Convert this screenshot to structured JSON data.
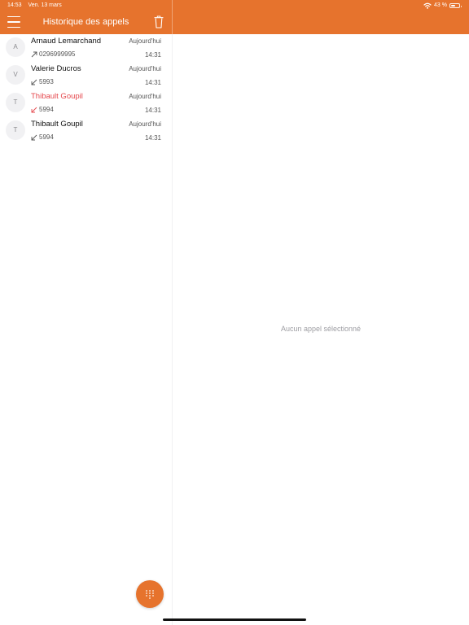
{
  "status_bar": {
    "time": "14:53",
    "date": "Ven. 13 mars",
    "battery": "43 %",
    "battery_level": 0.43
  },
  "header": {
    "title": "Historique des appels",
    "menu_icon": "hamburger-icon",
    "trash_icon": "trash-icon"
  },
  "colors": {
    "accent": "#e6732d",
    "missed": "#e5484d"
  },
  "calls": [
    {
      "initial": "A",
      "name": "Arnaud Lemarchand",
      "number": "0296999995",
      "date": "Aujourd'hui",
      "time": "14:31",
      "direction": "outgoing",
      "missed": false
    },
    {
      "initial": "V",
      "name": "Valerie Ducros",
      "number": "5993",
      "date": "Aujourd'hui",
      "time": "14:31",
      "direction": "incoming",
      "missed": false
    },
    {
      "initial": "T",
      "name": "Thibault Goupil",
      "number": "5994",
      "date": "Aujourd'hui",
      "time": "14:31",
      "direction": "incoming",
      "missed": true
    },
    {
      "initial": "T",
      "name": "Thibault Goupil",
      "number": "5994",
      "date": "Aujourd'hui",
      "time": "14:31",
      "direction": "incoming",
      "missed": false
    }
  ],
  "detail": {
    "empty_text": "Aucun appel sélectionné"
  },
  "dialpad_icon": "dialpad-icon"
}
